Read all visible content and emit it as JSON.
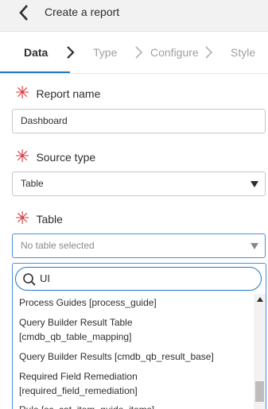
{
  "header": {
    "title": "Create a report"
  },
  "tabs": [
    {
      "label": "Data"
    },
    {
      "label": "Type"
    },
    {
      "label": "Configure"
    },
    {
      "label": "Style"
    }
  ],
  "form": {
    "report_name": {
      "label": "Report name",
      "value": "Dashboard"
    },
    "source_type": {
      "label": "Source type",
      "value": "Table"
    },
    "table": {
      "label": "Table",
      "placeholder": "No table selected"
    }
  },
  "dropdown": {
    "search_value": "UI",
    "results": [
      "Process Guides [process_guide]",
      "Query Builder Result Table",
      "[cmdb_qb_table_mapping]",
      "Query Builder Results [cmdb_qb_result_base]",
      "Required Field Remediation",
      "[required_field_remediation]",
      "Rule [sc_cat_item_guide_items]"
    ]
  },
  "colors": {
    "required": "#d9363e",
    "accent": "#1f77c4",
    "border_focus": "#4a90d9"
  }
}
